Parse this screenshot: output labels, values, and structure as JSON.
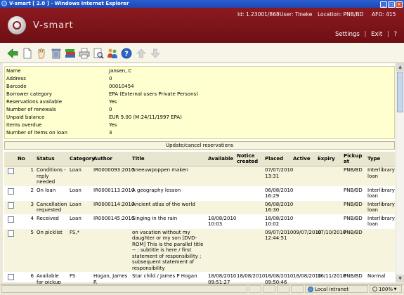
{
  "window": {
    "title": "V-smart [ 2.0 ] - Windows Internet Explorer"
  },
  "header": {
    "logo_text": "V-smart",
    "id_label": "Id: 1.23001/868",
    "user_label": "User: Tineke",
    "location_label": "Location: PNB/BD",
    "afo_label": "AFO: 415",
    "settings": "Settings",
    "exit": "Exit",
    "help": "?"
  },
  "toolbar": {
    "icons": [
      "back-arrow-icon",
      "new-document-icon",
      "hand-select-icon",
      "delete-bin-icon",
      "books-icon",
      "printer-icon",
      "print-preview-icon",
      "people-icon",
      "help-icon",
      "up-arrow-icon",
      "down-arrow-icon"
    ]
  },
  "borrower": {
    "fields": [
      {
        "label": "Name",
        "value": "Jansen, C"
      },
      {
        "label": "Address",
        "value": "0"
      },
      {
        "label": "Barcode",
        "value": "00010454"
      },
      {
        "label": "Borrower category",
        "value": "EPA (External users Private Persons)"
      },
      {
        "label": "Reservations available",
        "value": "Yes"
      },
      {
        "label": "Number of renewals",
        "value": "0"
      },
      {
        "label": "Unpaid balance",
        "value": "EUR 9.00 (M:24/11/1997 EPA)"
      },
      {
        "label": "Items overdue",
        "value": "Yes"
      },
      {
        "label": "Number of items on loan",
        "value": "3"
      }
    ]
  },
  "update_button": "Update/cancel reservations",
  "table": {
    "headers": [
      "",
      "No",
      "Status",
      "Category",
      "Author",
      "Title",
      "Available",
      "Notice created",
      "Placed",
      "Active",
      "Expiry",
      "Pickup at",
      "Type"
    ],
    "rows": [
      {
        "no": "1",
        "status": "Conditions - reply needed",
        "category": "Loan",
        "author": "IR0000093:2010",
        "title": "Sneeuwpoppen maken",
        "available": "",
        "notice": "",
        "placed": "07/07/2010 13:31",
        "active": "",
        "expiry": "",
        "pickup": "PNB/BD",
        "type": "Interlibrary loan"
      },
      {
        "no": "2",
        "status": "On loan",
        "category": "Loan",
        "author": "IR0000113:2010",
        "title": "A geography lesson",
        "available": "",
        "notice": "",
        "placed": "06/08/2010 16:29",
        "active": "",
        "expiry": "",
        "pickup": "PNB/BD",
        "type": "Interlibrary loan"
      },
      {
        "no": "3",
        "status": "Cancellation requested",
        "category": "Loan",
        "author": "IR0000114:2010",
        "title": "Ancient atlas of the world",
        "available": "",
        "notice": "",
        "placed": "06/08/2010 16:30",
        "active": "",
        "expiry": "",
        "pickup": "PNB/BD",
        "type": "Interlibrary loan"
      },
      {
        "no": "4",
        "status": "Received",
        "category": "Loan",
        "author": "IR0000145:2010",
        "title": "Singing in the rain",
        "available": "18/08/2010 10:03",
        "notice": "",
        "placed": "18/08/2010 10:02",
        "active": "",
        "expiry": "",
        "pickup": "PNB/BD",
        "type": "Interlibrary loan"
      },
      {
        "no": "5",
        "status": "On picklist",
        "category": "FS,*",
        "author": "",
        "title": "on vacation without my daughter or my son [DVD-ROM] This is the parallel title -- : subtitle is here / first statement of responsibility ; subsequent statement of responsibility",
        "available": "",
        "notice": "",
        "placed": "09/07/2010 12:44:51",
        "active": "09/07/2010",
        "expiry": "07/10/2010",
        "pickup": "PNB/BD",
        "type": ""
      },
      {
        "no": "6",
        "status": "Available for pickup",
        "category": "FS",
        "author": "Hogan, James P.",
        "title": "Star child / James P Hogan",
        "available": "18/08/2010 09:51:27",
        "notice": "18/08/2010",
        "placed": "18/08/2010 09:50:46",
        "active": "18/08/2010",
        "expiry": "16/11/2010",
        "pickup": "PNB/BD",
        "type": "Normal"
      }
    ]
  },
  "statusbar": {
    "zone": "Local intranet",
    "zoom": "100%"
  },
  "colors": {
    "header": "#8b1a20",
    "info_bg": "#ffffd0",
    "title_blue": "#1d48b8"
  }
}
